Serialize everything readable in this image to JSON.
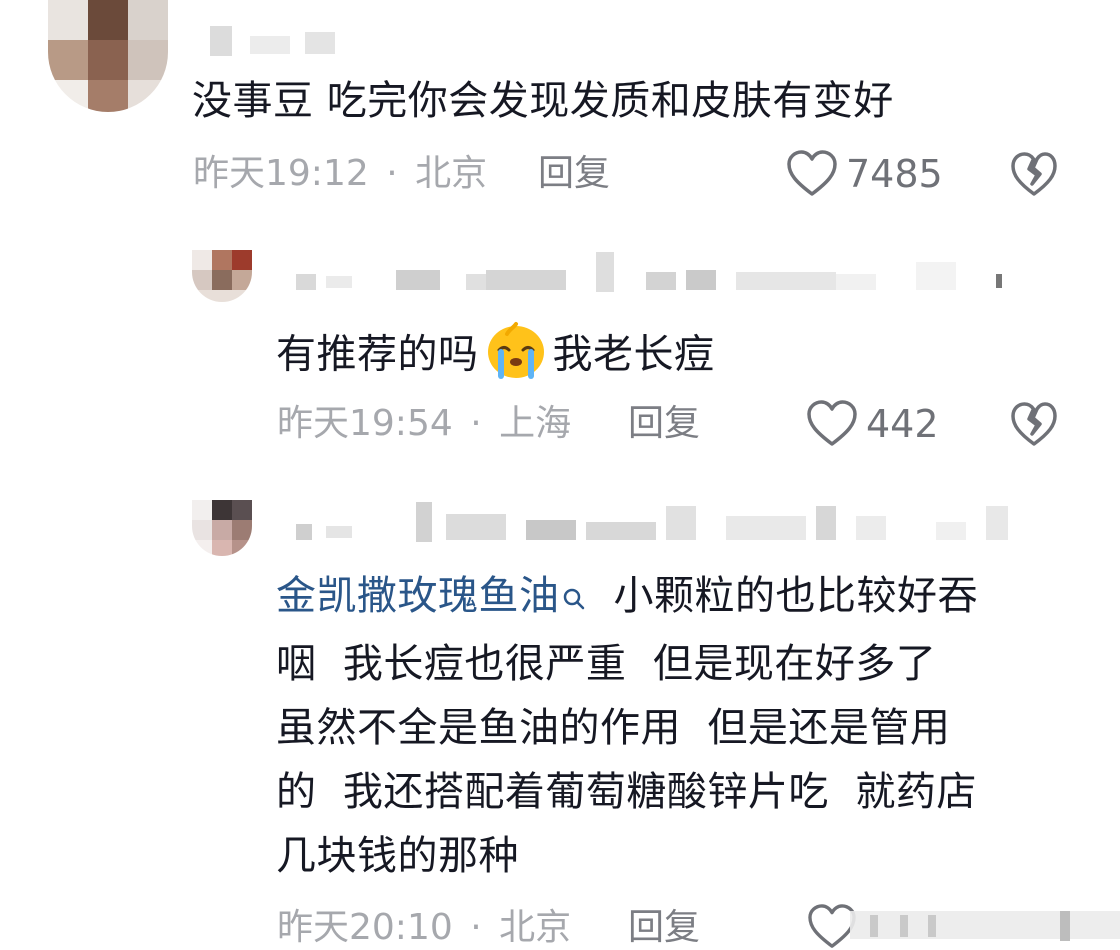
{
  "comments": [
    {
      "text": "没事豆 吃完你会发现发质和皮肤有变好",
      "time": "昨天19:12",
      "location": "北京",
      "reply_label": "回复",
      "likes": "7485"
    },
    {
      "text_before_emoji": "有推荐的吗",
      "emoji": "crying-face-emoji",
      "text_after_emoji": "我老长痘",
      "time": "昨天19:54",
      "location": "上海",
      "reply_label": "回复",
      "likes": "442"
    },
    {
      "link_text": "金凯撒玫瑰鱼油",
      "line1": "小颗粒的也比较好吞",
      "line2": "咽  我长痘也很严重  但是现在好多了",
      "line3": "虽然不全是鱼油的作用  但是还是管用",
      "line4": "的  我还搭配着葡萄糖酸锌片吃  就药店",
      "line5": "几块钱的那种",
      "time": "昨天20:10",
      "location": "北京",
      "reply_label": "回复"
    }
  ],
  "separator": "·",
  "icons": {
    "like": "heart-outline-icon",
    "dislike": "broken-heart-icon",
    "search": "search-icon"
  },
  "colors": {
    "text": "#161823",
    "meta": "#a6a8ad",
    "link": "#2a5689",
    "icon": "#6f7177"
  }
}
